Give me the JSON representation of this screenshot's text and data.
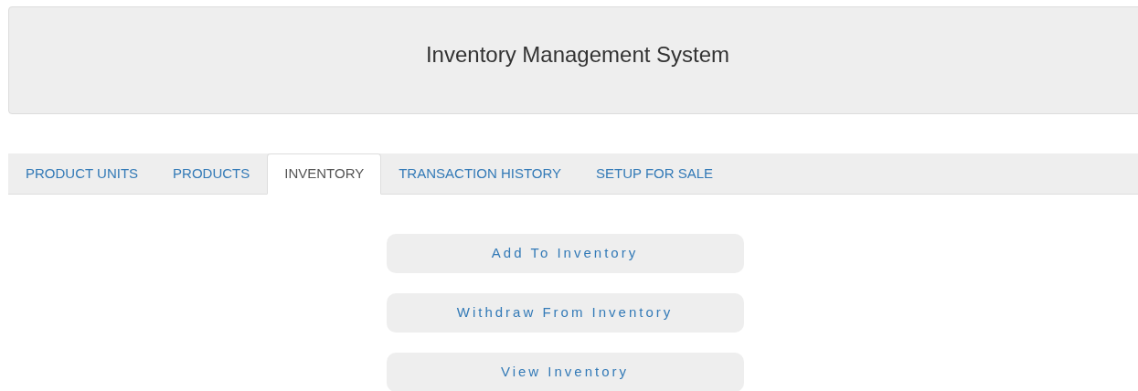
{
  "header": {
    "title": "Inventory Management System"
  },
  "tabs": [
    {
      "label": "PRODUCT UNITS",
      "selected": false
    },
    {
      "label": "PRODUCTS",
      "selected": false
    },
    {
      "label": "INVENTORY",
      "selected": true
    },
    {
      "label": "TRANSACTION HISTORY",
      "selected": false
    },
    {
      "label": "SETUP FOR SALE",
      "selected": false
    }
  ],
  "actions": [
    {
      "label": "Add To Inventory"
    },
    {
      "label": "Withdraw From Inventory"
    },
    {
      "label": "View Inventory"
    }
  ]
}
